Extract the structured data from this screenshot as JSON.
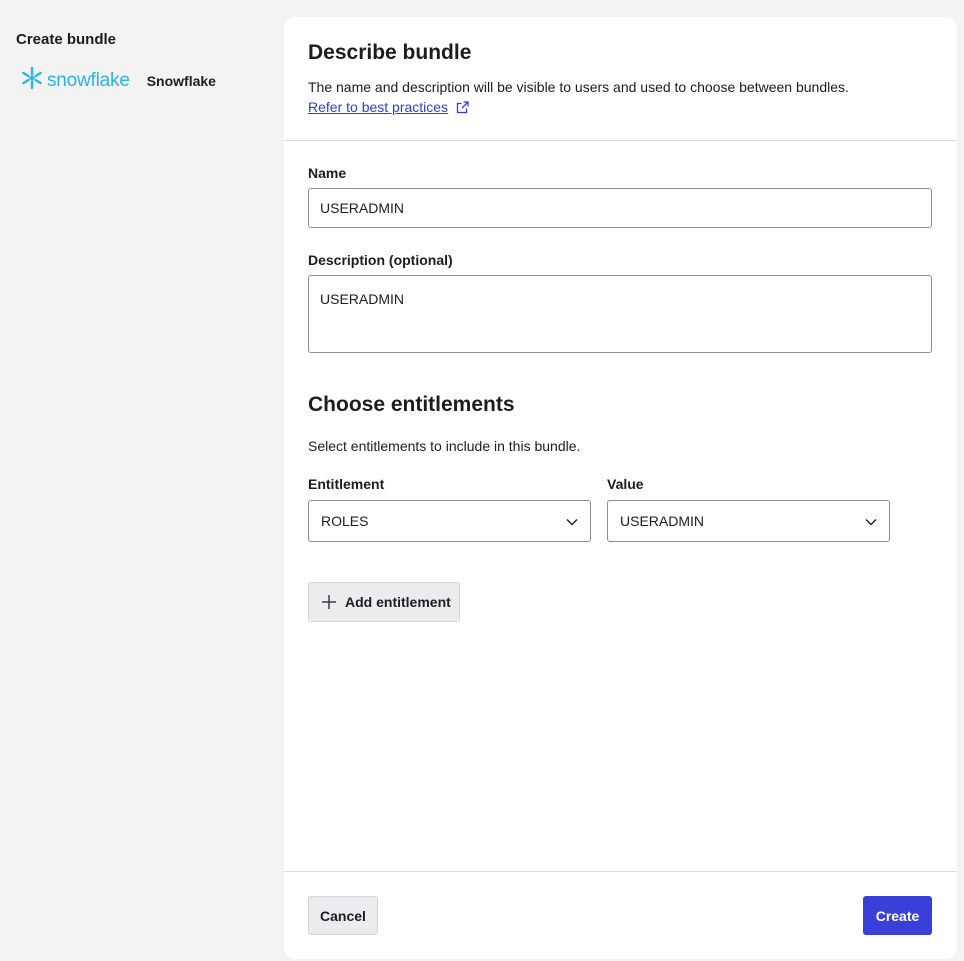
{
  "sidebar": {
    "title": "Create bundle",
    "app_logo_text": "snowflake",
    "app_logo_icon": "snowflake-icon",
    "app_name": "Snowflake"
  },
  "header": {
    "title": "Describe bundle",
    "description": "The name and description will be visible to users and used to choose between bundles.",
    "link_text": "Refer to best practices",
    "link_icon": "external-link-icon"
  },
  "form": {
    "name_label": "Name",
    "name_value": "USERADMIN",
    "description_label": "Description (optional)",
    "description_value": "USERADMIN"
  },
  "entitlements": {
    "title": "Choose entitlements",
    "description": "Select entitlements to include in this bundle.",
    "entitlement_label": "Entitlement",
    "entitlement_value": "ROLES",
    "value_label": "Value",
    "value_value": "USERADMIN",
    "add_button": "Add entitlement"
  },
  "footer": {
    "cancel": "Cancel",
    "create": "Create"
  },
  "colors": {
    "accent": "#3a3fd8",
    "link": "#2c3fd8",
    "brand_snowflake": "#29b5e8",
    "background": "#f3f3f4"
  }
}
